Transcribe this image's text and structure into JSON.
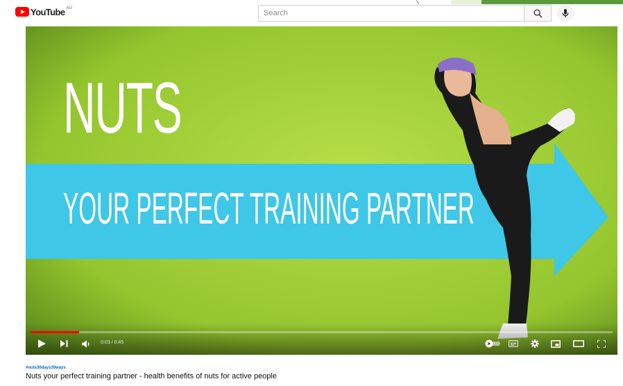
{
  "header": {
    "logo_text": "YouTube",
    "region": "AU",
    "search_placeholder": "Search",
    "icons": [
      "youtube-logo-icon",
      "search-icon",
      "microphone-icon"
    ]
  },
  "video": {
    "overlay_title": "NUTS",
    "overlay_banner": "YOUR PERFECT TRAINING PARTNER",
    "time": "0:03 / 0:45",
    "progress": 0.084,
    "colors": {
      "background": "#8fc12b",
      "banner": "#3ec7e6",
      "progress": "#ff0000"
    },
    "controls": [
      "play-icon",
      "next-icon",
      "volume-icon",
      "autoplay-toggle-icon",
      "subtitles-icon",
      "settings-icon",
      "miniplayer-icon",
      "theater-icon",
      "fullscreen-icon"
    ]
  },
  "meta": {
    "hashtag": "#nuts30days30ways",
    "title": "Nuts your perfect training partner - health benefits of nuts for active people"
  }
}
